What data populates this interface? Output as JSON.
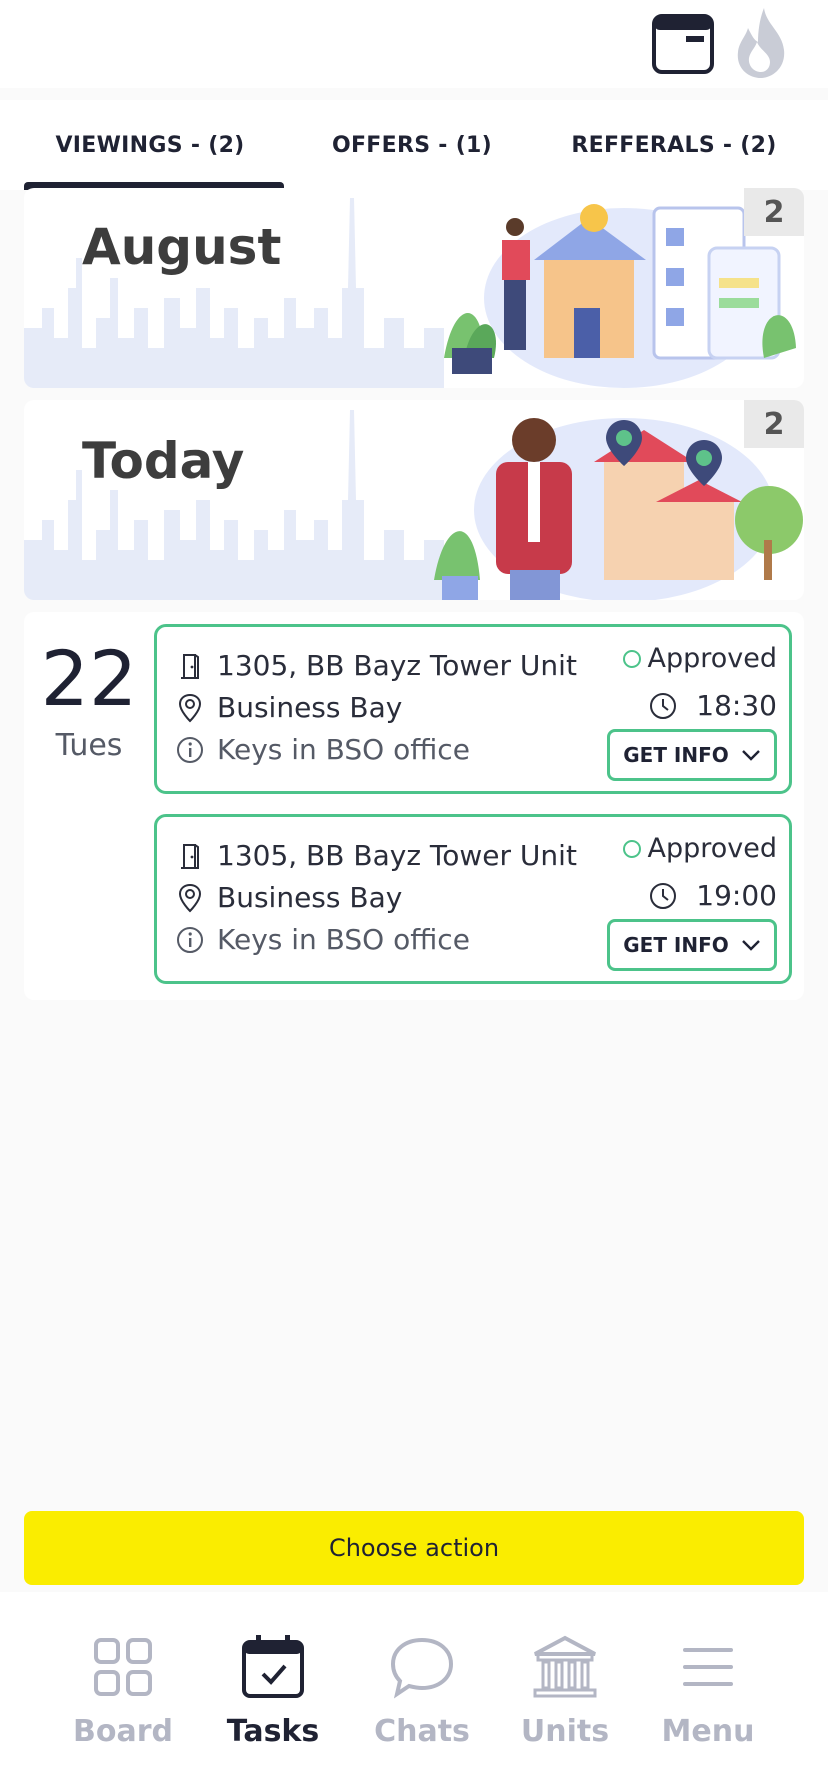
{
  "header": {
    "calendar_icon": "calendar-icon",
    "flame_icon": "flame-icon"
  },
  "tabs": [
    {
      "label": "VIEWINGS - (2)",
      "active": true
    },
    {
      "label": "OFFERS - (1)",
      "active": false
    },
    {
      "label": "REFFERALS - (2)",
      "active": false
    }
  ],
  "banners": [
    {
      "title": "August",
      "count": "2"
    },
    {
      "title": "Today",
      "count": "2"
    }
  ],
  "day": {
    "number": "22",
    "name": "Tues"
  },
  "viewings": [
    {
      "unit": "1305, BB Bayz Tower Unit",
      "location": "Business Bay",
      "note": "Keys in BSO office",
      "status": "Approved",
      "time": "18:30",
      "button": "GET INFO"
    },
    {
      "unit": "1305, BB Bayz Tower Unit",
      "location": "Business Bay",
      "note": "Keys in BSO office",
      "status": "Approved",
      "time": "19:00",
      "button": "GET INFO"
    }
  ],
  "choose_action": "Choose action",
  "nav": [
    {
      "label": "Board",
      "icon": "grid-icon",
      "active": false
    },
    {
      "label": "Tasks",
      "icon": "calendar-check-icon",
      "active": true
    },
    {
      "label": "Chats",
      "icon": "chat-bubble-icon",
      "active": false
    },
    {
      "label": "Units",
      "icon": "building-columns-icon",
      "active": false
    },
    {
      "label": "Menu",
      "icon": "hamburger-icon",
      "active": false
    }
  ],
  "colors": {
    "accent_green": "#4cc38a",
    "action_yellow": "#faed00",
    "ink": "#1f2233",
    "muted": "#b3b6c4"
  }
}
